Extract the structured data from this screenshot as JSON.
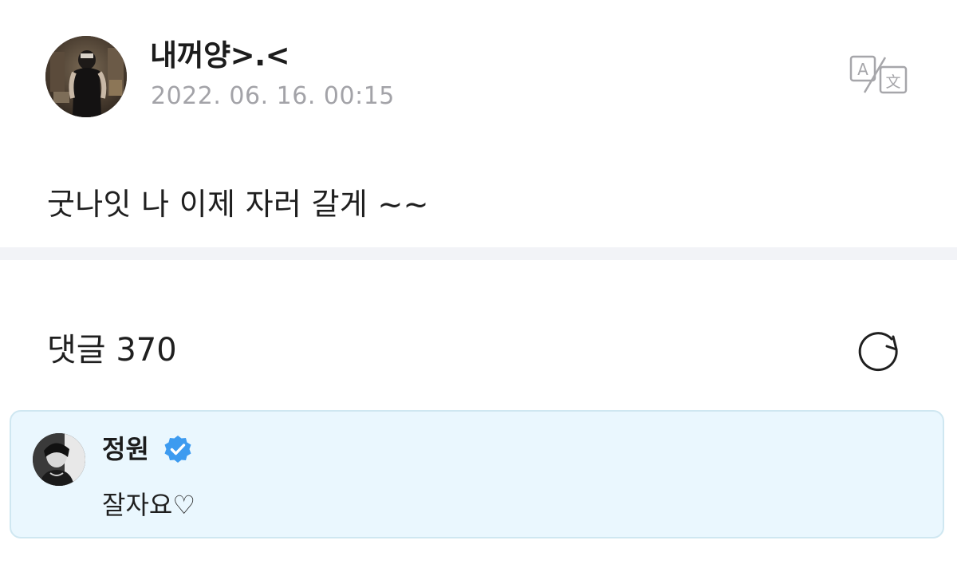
{
  "post": {
    "author": "내꺼양>.<",
    "timestamp": "2022. 06. 16. 00:15",
    "body": "굿나잇 나 이제 자러 갈게 ~~",
    "translate_icon": "translate-icon"
  },
  "comments": {
    "title": "댓글 370",
    "refresh_icon": "refresh-icon",
    "items": [
      {
        "author": "정원",
        "verified": true,
        "text": "잘자요♡"
      }
    ]
  },
  "colors": {
    "timestamp": "#a3a3a8",
    "divider": "#f2f3f7",
    "comment_card_bg": "#eaf7fe",
    "comment_card_border": "#cfe7f1",
    "verified_badge": "#3d9bf0"
  }
}
